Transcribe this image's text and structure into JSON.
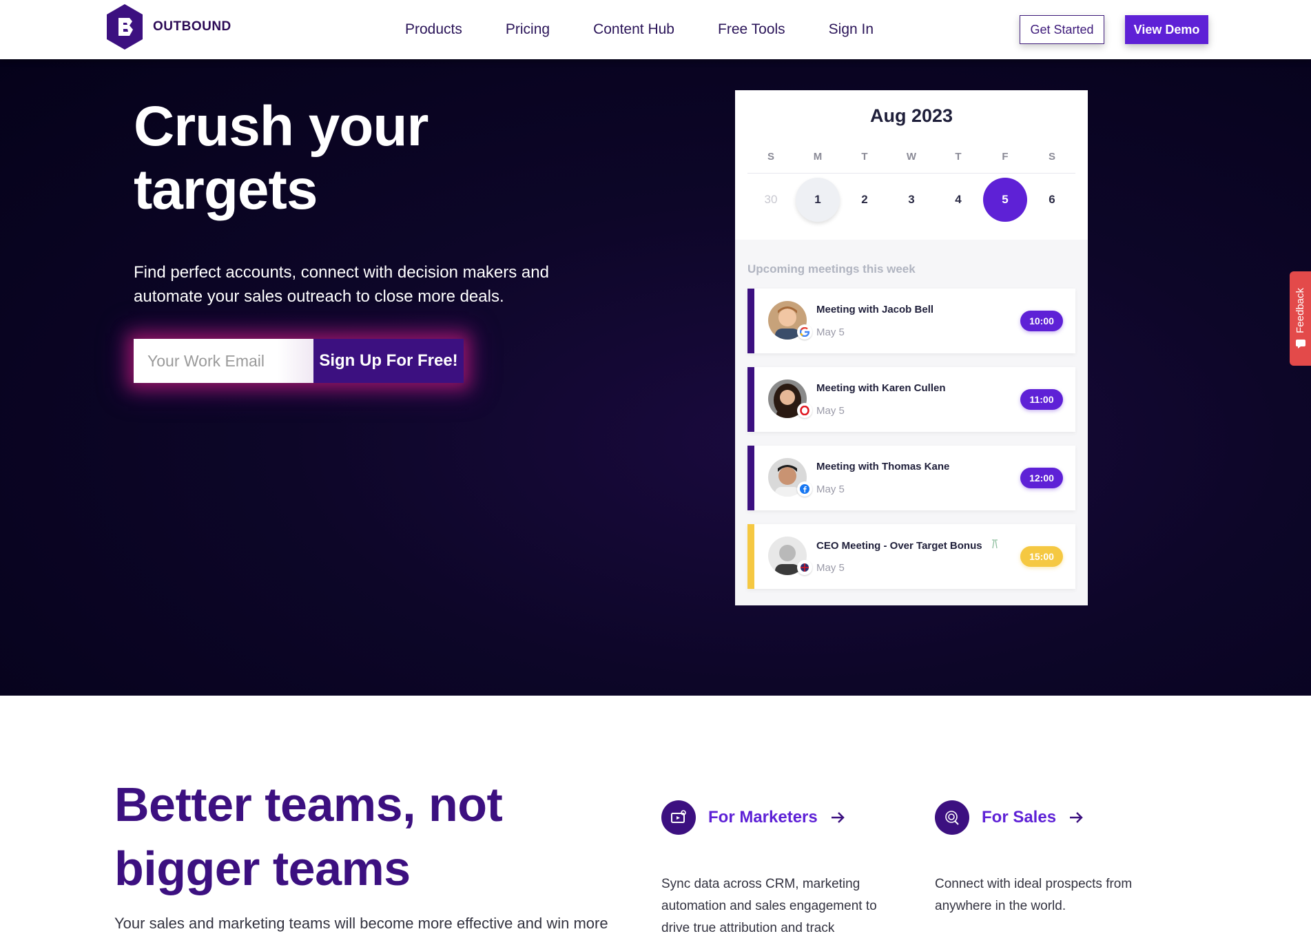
{
  "nav": {
    "logo_text": "OUTBOUND",
    "links": [
      "Products",
      "Pricing",
      "Content Hub",
      "Free Tools",
      "Sign In"
    ],
    "get_started": "Get Started",
    "view_demo": "View Demo"
  },
  "hero": {
    "title": "Crush your targets",
    "subtitle": "Find perfect accounts, connect with decision makers and automate your sales outreach to close more deals.",
    "email_placeholder": "Your Work Email",
    "signup_label": "Sign Up For Free!"
  },
  "calendar": {
    "month": "Aug 2023",
    "day_names": [
      "S",
      "M",
      "T",
      "W",
      "T",
      "F",
      "S"
    ],
    "dates": [
      "30",
      "1",
      "2",
      "3",
      "4",
      "5",
      "6"
    ],
    "upcoming_title": "Upcoming meetings this week",
    "meetings": [
      {
        "title": "Meeting with Jacob Bell",
        "date": "May 5",
        "time": "10:00",
        "source_icon": "google-icon"
      },
      {
        "title": "Meeting with Karen Cullen",
        "date": "May 5",
        "time": "11:00",
        "source_icon": "opera-icon"
      },
      {
        "title": "Meeting with Thomas Kane",
        "date": "May 5",
        "time": "12:00",
        "source_icon": "facebook-icon"
      },
      {
        "title": "CEO Meeting - Over Target Bonus",
        "date": "May 5",
        "time": "15:00",
        "source_icon": "globe-icon"
      }
    ]
  },
  "feedback_label": "Feedback",
  "section": {
    "title": "Better teams, not bigger teams",
    "subtitle": "Your sales and marketing teams will become more effective and win more",
    "marketers": {
      "label": "For Marketers",
      "desc": "Sync data across CRM, marketing automation and sales engagement to drive true attribution and track"
    },
    "sales": {
      "label": "For Sales",
      "desc": "Connect with ideal prospects from anywhere in the world."
    }
  },
  "colors": {
    "brand_purple": "#5e21d6",
    "deep_purple": "#3c1080",
    "gold": "#f5c842",
    "feedback_red": "#e34a4a"
  }
}
